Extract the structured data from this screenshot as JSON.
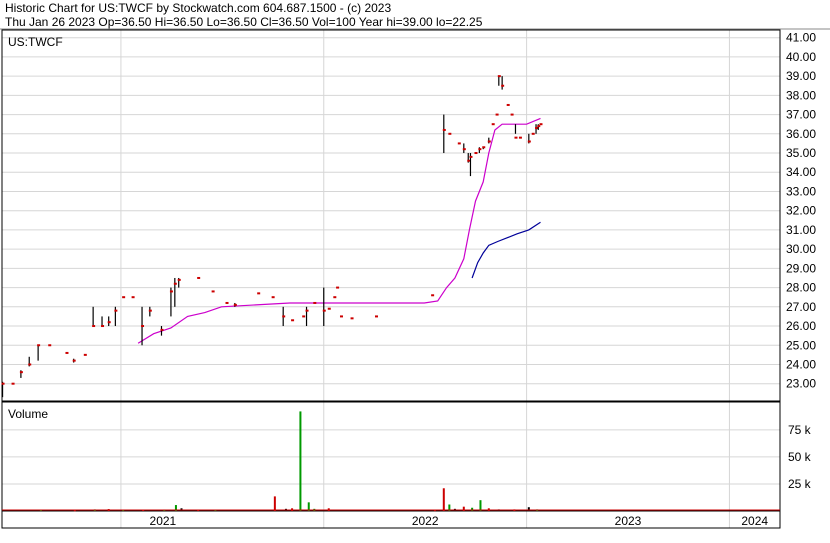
{
  "header": {
    "title": "Historic Chart for US:TWCF by Stockwatch.com 604.687.1500 - (c) 2023",
    "info": "Thu Jan 26 2023  Op=36.50  Hi=36.50  Lo=36.50  Cl=36.50  Vol=100  Year hi=39.00  lo=22.25"
  },
  "chart_data": [
    {
      "type": "line",
      "title": "US:TWCF",
      "x_range": [
        "2020-06",
        "2024-04"
      ],
      "y_tick_labels": [
        "41.00",
        "40.00",
        "39.00",
        "38.00",
        "37.00",
        "36.00",
        "35.00",
        "34.00",
        "33.00",
        "32.00",
        "31.00",
        "30.00",
        "29.00",
        "28.00",
        "27.00",
        "26.00",
        "25.00",
        "24.00",
        "23.00"
      ],
      "ylim": [
        22.1,
        41.4
      ],
      "x_tick_labels": [
        "2021",
        "2022",
        "2023",
        "2024"
      ],
      "grid": true,
      "colors": {
        "price_bar": "#000000",
        "close_dot": "#cc0000",
        "ma_short": "#cc00cc",
        "ma_long": "#000099"
      },
      "series": [
        {
          "role": "price",
          "data": [
            {
              "x": "2020-06-02",
              "l": 22.3,
              "h": 23.1,
              "c": 23.0
            },
            {
              "x": "2020-06-20",
              "l": 23.0,
              "h": 23.0,
              "c": 23.0
            },
            {
              "x": "2020-07-05",
              "l": 23.3,
              "h": 23.7,
              "c": 23.6
            },
            {
              "x": "2020-07-20",
              "l": 23.9,
              "h": 24.4,
              "c": 24.0
            },
            {
              "x": "2020-08-05",
              "l": 24.2,
              "h": 25.0,
              "c": 25.0
            },
            {
              "x": "2020-08-25",
              "l": 25.0,
              "h": 25.0,
              "c": 25.0
            },
            {
              "x": "2020-09-25",
              "l": 24.6,
              "h": 24.6,
              "c": 24.6
            },
            {
              "x": "2020-10-08",
              "l": 24.1,
              "h": 24.3,
              "c": 24.2
            },
            {
              "x": "2020-10-28",
              "l": 24.5,
              "h": 24.5,
              "c": 24.5
            },
            {
              "x": "2020-11-12",
              "l": 26.0,
              "h": 27.0,
              "c": 26.0
            },
            {
              "x": "2020-11-28",
              "l": 26.0,
              "h": 26.5,
              "c": 26.0
            },
            {
              "x": "2020-12-10",
              "l": 26.0,
              "h": 26.5,
              "c": 26.2
            },
            {
              "x": "2020-12-22",
              "l": 26.0,
              "h": 27.0,
              "c": 26.8
            },
            {
              "x": "2021-01-05",
              "l": 27.5,
              "h": 27.5,
              "c": 27.5
            },
            {
              "x": "2021-01-22",
              "l": 27.5,
              "h": 27.5,
              "c": 27.5
            },
            {
              "x": "2021-02-08",
              "l": 25.0,
              "h": 27.0,
              "c": 26.0
            },
            {
              "x": "2021-02-22",
              "l": 26.5,
              "h": 27.0,
              "c": 26.8
            },
            {
              "x": "2021-03-15",
              "l": 25.5,
              "h": 26.0,
              "c": 25.8
            },
            {
              "x": "2021-04-01",
              "l": 26.5,
              "h": 28.0,
              "c": 27.8
            },
            {
              "x": "2021-04-08",
              "l": 27.0,
              "h": 28.5,
              "c": 28.2
            },
            {
              "x": "2021-04-15",
              "l": 28.0,
              "h": 28.5,
              "c": 28.4
            },
            {
              "x": "2021-05-20",
              "l": 28.5,
              "h": 28.5,
              "c": 28.5
            },
            {
              "x": "2021-06-15",
              "l": 27.8,
              "h": 27.8,
              "c": 27.8
            },
            {
              "x": "2021-07-10",
              "l": 27.2,
              "h": 27.2,
              "c": 27.2
            },
            {
              "x": "2021-07-25",
              "l": 27.0,
              "h": 27.2,
              "c": 27.1
            },
            {
              "x": "2021-09-05",
              "l": 27.7,
              "h": 27.7,
              "c": 27.7
            },
            {
              "x": "2021-10-01",
              "l": 27.5,
              "h": 27.5,
              "c": 27.5
            },
            {
              "x": "2021-10-20",
              "l": 26.0,
              "h": 27.0,
              "c": 26.5
            },
            {
              "x": "2021-11-05",
              "l": 26.3,
              "h": 26.3,
              "c": 26.3
            },
            {
              "x": "2021-11-25",
              "l": 26.5,
              "h": 26.5,
              "c": 26.5
            },
            {
              "x": "2021-12-01",
              "l": 26.0,
              "h": 27.0,
              "c": 26.8
            },
            {
              "x": "2021-12-15",
              "l": 27.2,
              "h": 27.2,
              "c": 27.2
            },
            {
              "x": "2022-01-01",
              "l": 26.0,
              "h": 28.0,
              "c": 26.8
            },
            {
              "x": "2022-01-10",
              "l": 26.9,
              "h": 26.9,
              "c": 26.9
            },
            {
              "x": "2022-01-20",
              "l": 27.5,
              "h": 27.5,
              "c": 27.5
            },
            {
              "x": "2022-01-25",
              "l": 28.0,
              "h": 28.0,
              "c": 28.0
            },
            {
              "x": "2022-02-01",
              "l": 26.5,
              "h": 26.5,
              "c": 26.5
            },
            {
              "x": "2022-02-20",
              "l": 26.4,
              "h": 26.4,
              "c": 26.4
            },
            {
              "x": "2022-04-05",
              "l": 26.5,
              "h": 26.5,
              "c": 26.5
            },
            {
              "x": "2022-07-15",
              "l": 27.6,
              "h": 27.6,
              "c": 27.6
            },
            {
              "x": "2022-08-05",
              "l": 35.0,
              "h": 37.0,
              "c": 36.2
            },
            {
              "x": "2022-08-15",
              "l": 36.0,
              "h": 36.0,
              "c": 36.0
            },
            {
              "x": "2022-09-01",
              "l": 35.5,
              "h": 35.5,
              "c": 35.5
            },
            {
              "x": "2022-09-10",
              "l": 35.0,
              "h": 35.5,
              "c": 35.2
            },
            {
              "x": "2022-09-18",
              "l": 34.5,
              "h": 35.0,
              "c": 34.6
            },
            {
              "x": "2022-09-22",
              "l": 33.8,
              "h": 35.0,
              "c": 34.8
            },
            {
              "x": "2022-10-01",
              "l": 35.0,
              "h": 35.0,
              "c": 35.0
            },
            {
              "x": "2022-10-08",
              "l": 35.0,
              "h": 35.3,
              "c": 35.2
            },
            {
              "x": "2022-10-15",
              "l": 35.2,
              "h": 35.3,
              "c": 35.3
            },
            {
              "x": "2022-10-25",
              "l": 35.5,
              "h": 35.8,
              "c": 35.6
            },
            {
              "x": "2022-11-01",
              "l": 36.5,
              "h": 36.5,
              "c": 36.5
            },
            {
              "x": "2022-11-08",
              "l": 37.0,
              "h": 37.0,
              "c": 37.0
            },
            {
              "x": "2022-11-12",
              "l": 38.5,
              "h": 39.0,
              "c": 39.0
            },
            {
              "x": "2022-11-18",
              "l": 38.3,
              "h": 39.0,
              "c": 38.5
            },
            {
              "x": "2022-11-28",
              "l": 37.5,
              "h": 37.5,
              "c": 37.5
            },
            {
              "x": "2022-12-05",
              "l": 37.0,
              "h": 37.0,
              "c": 37.0
            },
            {
              "x": "2022-12-12",
              "l": 36.0,
              "h": 36.5,
              "c": 35.8
            },
            {
              "x": "2022-12-20",
              "l": 35.8,
              "h": 35.8,
              "c": 35.8
            },
            {
              "x": "2023-01-05",
              "l": 35.5,
              "h": 36.0,
              "c": 35.6
            },
            {
              "x": "2023-01-12",
              "l": 36.0,
              "h": 36.0,
              "c": 36.0
            },
            {
              "x": "2023-01-18",
              "l": 36.0,
              "h": 36.5,
              "c": 36.3
            },
            {
              "x": "2023-01-22",
              "l": 36.2,
              "h": 36.5,
              "c": 36.4
            },
            {
              "x": "2023-01-26",
              "l": 36.5,
              "h": 36.5,
              "c": 36.5
            }
          ]
        },
        {
          "role": "ma_short",
          "data": [
            [
              "2021-02-01",
              25.1
            ],
            [
              "2021-03-01",
              25.6
            ],
            [
              "2021-04-01",
              25.9
            ],
            [
              "2021-05-01",
              26.5
            ],
            [
              "2021-06-01",
              26.7
            ],
            [
              "2021-07-01",
              27.0
            ],
            [
              "2021-09-01",
              27.1
            ],
            [
              "2021-11-01",
              27.2
            ],
            [
              "2022-01-01",
              27.2
            ],
            [
              "2022-04-01",
              27.2
            ],
            [
              "2022-07-01",
              27.2
            ],
            [
              "2022-07-25",
              27.3
            ],
            [
              "2022-08-10",
              28.0
            ],
            [
              "2022-08-25",
              28.5
            ],
            [
              "2022-09-10",
              29.5
            ],
            [
              "2022-09-20",
              31.0
            ],
            [
              "2022-10-01",
              32.5
            ],
            [
              "2022-10-15",
              33.5
            ],
            [
              "2022-10-25",
              35.0
            ],
            [
              "2022-11-05",
              36.2
            ],
            [
              "2022-11-18",
              36.5
            ],
            [
              "2022-12-10",
              36.5
            ],
            [
              "2023-01-01",
              36.5
            ],
            [
              "2023-01-26",
              36.8
            ]
          ]
        },
        {
          "role": "ma_long",
          "data": [
            [
              "2022-09-25",
              28.5
            ],
            [
              "2022-10-05",
              29.3
            ],
            [
              "2022-10-15",
              29.8
            ],
            [
              "2022-10-25",
              30.2
            ],
            [
              "2022-11-10",
              30.4
            ],
            [
              "2022-11-28",
              30.6
            ],
            [
              "2022-12-15",
              30.8
            ],
            [
              "2023-01-05",
              31.0
            ],
            [
              "2023-01-26",
              31.4
            ]
          ]
        }
      ]
    },
    {
      "type": "bar",
      "title": "Volume",
      "y_tick_labels": [
        "75 k",
        "50 k",
        "25 k"
      ],
      "ylim": [
        0,
        97000
      ],
      "colors": {
        "up": "#009900",
        "down": "#cc0000",
        "flat": "#000000"
      },
      "series": [
        {
          "data": [
            [
              "2020-06-05",
              800,
              "flat"
            ],
            [
              "2020-07-10",
              500,
              "flat"
            ],
            [
              "2020-08-10",
              900,
              "up"
            ],
            [
              "2020-09-20",
              600,
              "flat"
            ],
            [
              "2020-10-10",
              700,
              "down"
            ],
            [
              "2020-11-15",
              1500,
              "up"
            ],
            [
              "2020-12-10",
              1800,
              "down"
            ],
            [
              "2021-01-05",
              900,
              "up"
            ],
            [
              "2021-02-10",
              1000,
              "down"
            ],
            [
              "2021-03-20",
              1400,
              "up"
            ],
            [
              "2021-04-10",
              5500,
              "up"
            ],
            [
              "2021-04-20",
              2500,
              "flat"
            ],
            [
              "2021-05-20",
              900,
              "down"
            ],
            [
              "2021-06-20",
              1200,
              "up"
            ],
            [
              "2021-07-15",
              500,
              "flat"
            ],
            [
              "2021-09-10",
              1200,
              "flat"
            ],
            [
              "2021-10-05",
              13500,
              "down"
            ],
            [
              "2021-10-25",
              2000,
              "flat"
            ],
            [
              "2021-11-05",
              2500,
              "down"
            ],
            [
              "2021-11-20",
              92000,
              "up"
            ],
            [
              "2021-12-05",
              8000,
              "up"
            ],
            [
              "2021-12-15",
              2000,
              "up"
            ],
            [
              "2022-01-10",
              2500,
              "down"
            ],
            [
              "2022-02-15",
              1200,
              "flat"
            ],
            [
              "2022-04-10",
              900,
              "flat"
            ],
            [
              "2022-07-20",
              800,
              "down"
            ],
            [
              "2022-08-05",
              21000,
              "down"
            ],
            [
              "2022-08-15",
              6000,
              "up"
            ],
            [
              "2022-08-25",
              2000,
              "flat"
            ],
            [
              "2022-09-10",
              4000,
              "down"
            ],
            [
              "2022-09-25",
              3000,
              "up"
            ],
            [
              "2022-10-10",
              10000,
              "up"
            ],
            [
              "2022-10-25",
              2500,
              "down"
            ],
            [
              "2022-11-12",
              1500,
              "flat"
            ],
            [
              "2022-12-10",
              1500,
              "down"
            ],
            [
              "2023-01-05",
              3500,
              "flat"
            ],
            [
              "2023-01-20",
              1500,
              "up"
            ]
          ]
        }
      ]
    }
  ]
}
